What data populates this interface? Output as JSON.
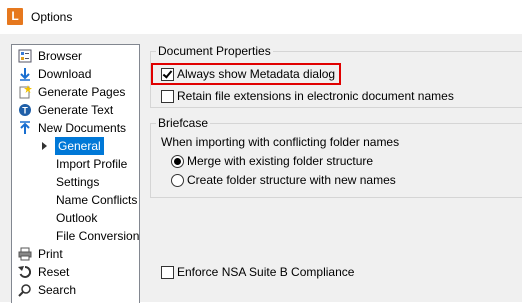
{
  "window": {
    "title": "Options",
    "app_icon_letter": "L"
  },
  "tree": {
    "items": [
      {
        "label": "Browser",
        "icon": "browser-icon"
      },
      {
        "label": "Download",
        "icon": "download-arrow-icon"
      },
      {
        "label": "Generate Pages",
        "icon": "generate-pages-icon"
      },
      {
        "label": "Generate Text",
        "icon": "generate-text-icon"
      },
      {
        "label": "New Documents",
        "icon": "upload-arrow-icon"
      },
      {
        "label": "General",
        "selected": true
      },
      {
        "label": "Import Profile"
      },
      {
        "label": "Settings"
      },
      {
        "label": "Name Conflicts"
      },
      {
        "label": "Outlook"
      },
      {
        "label": "File Conversion"
      },
      {
        "label": "Print",
        "icon": "printer-icon"
      },
      {
        "label": "Reset",
        "icon": "reset-icon"
      },
      {
        "label": "Search",
        "icon": "search-icon"
      }
    ]
  },
  "document_properties": {
    "title": "Document Properties",
    "always_show_metadata": {
      "label": "Always show Metadata dialog",
      "checked": true
    },
    "retain_extensions": {
      "label": "Retain file extensions in electronic document names",
      "checked": false
    }
  },
  "briefcase": {
    "title": "Briefcase",
    "conflict_prompt": "When importing with conflicting folder names",
    "merge_option": {
      "label": "Merge with existing folder structure",
      "selected": true
    },
    "create_option": {
      "label": "Create folder structure with new names",
      "selected": false
    }
  },
  "nsa": {
    "label": "Enforce NSA Suite B Compliance",
    "checked": false
  },
  "colors": {
    "accent": "#0078d7",
    "highlight": "#e00000",
    "app_icon": "#e6781e"
  }
}
